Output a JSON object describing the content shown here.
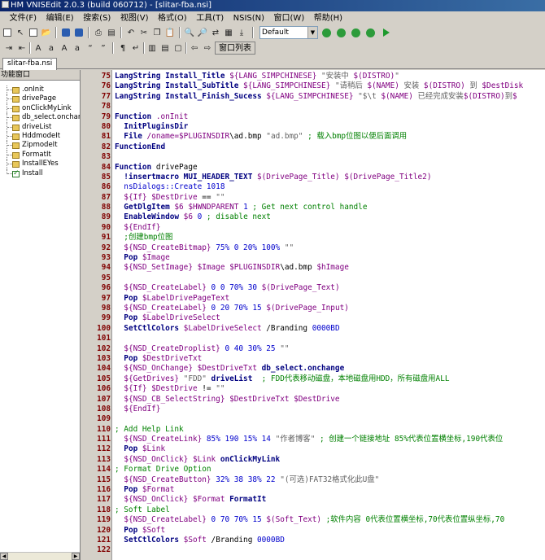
{
  "window": {
    "title": "HM VNISEdit 2.0.3 (build 060712) - [slitar-fba.nsi]"
  },
  "menu": [
    "文件(F)",
    "编辑(E)",
    "搜索(S)",
    "视图(V)",
    "格式(O)",
    "工具(T)",
    "NSIS(N)",
    "窗口(W)",
    "帮助(H)"
  ],
  "toolbar": {
    "scheme_value": "Default",
    "window_list_label": "窗口列表"
  },
  "tabs": [
    {
      "label": "slitar-fba.nsi",
      "active": true
    }
  ],
  "sidebar": {
    "title": "功能窗口",
    "items": [
      {
        "label": ".onInit",
        "icon": "function-icon"
      },
      {
        "label": "drivePage",
        "icon": "function-icon"
      },
      {
        "label": "onClickMyLink",
        "icon": "function-icon"
      },
      {
        "label": "db_select.onchar",
        "icon": "function-icon"
      },
      {
        "label": "driveList",
        "icon": "function-icon"
      },
      {
        "label": "HddmodeIt",
        "icon": "function-icon"
      },
      {
        "label": "ZipmodeIt",
        "icon": "function-icon"
      },
      {
        "label": "FormatIt",
        "icon": "function-icon"
      },
      {
        "label": "InstallEYes",
        "icon": "function-icon"
      },
      {
        "label": "Install",
        "icon": "section-check-icon"
      }
    ]
  },
  "code_lines": [
    {
      "n": "75",
      "t": [
        [
          "kw",
          "LangString Install_Title "
        ],
        [
          "var",
          "${LANG_SIMPCHINESE} "
        ],
        [
          "str",
          "\"安装中 "
        ],
        [
          "var",
          "$(DISTRO)"
        ],
        [
          "str",
          "\""
        ]
      ]
    },
    {
      "n": "76",
      "t": [
        [
          "kw",
          "LangString Install_SubTitle "
        ],
        [
          "var",
          "${LANG_SIMPCHINESE} "
        ],
        [
          "str",
          "\"请稍后 "
        ],
        [
          "var",
          "$(NAME)"
        ],
        [
          "str",
          " 安装 "
        ],
        [
          "var",
          "$(DISTRO)"
        ],
        [
          "str",
          " 到 "
        ],
        [
          "var",
          "$DestDisk"
        ]
      ]
    },
    {
      "n": "77",
      "t": [
        [
          "kw",
          "LangString Install_Finish_Sucess "
        ],
        [
          "var",
          "${LANG_SIMPCHINESE} "
        ],
        [
          "str",
          "\"$\\t "
        ],
        [
          "var",
          "$(NAME)"
        ],
        [
          "str",
          " 已经完成安装"
        ],
        [
          "var",
          "$(DISTRO)"
        ],
        [
          "str",
          "到"
        ],
        [
          "var",
          "$"
        ]
      ]
    },
    {
      "n": "78",
      "t": []
    },
    {
      "n": "79",
      "t": [
        [
          "kw",
          "Function "
        ],
        [
          "var",
          ".onInit"
        ]
      ]
    },
    {
      "n": "80",
      "t": [
        [
          "plain",
          "  "
        ],
        [
          "kw",
          "InitPluginsDir"
        ]
      ]
    },
    {
      "n": "81",
      "t": [
        [
          "plain",
          "  "
        ],
        [
          "kw",
          "File "
        ],
        [
          "var",
          "/oname=$PLUGINSDIR"
        ],
        [
          "plain",
          "\\ad.bmp "
        ],
        [
          "str",
          "\"ad.bmp\""
        ],
        [
          "cm",
          " ; 载入bmp位图以便后面调用"
        ]
      ]
    },
    {
      "n": "82",
      "t": [
        [
          "kw",
          "FunctionEnd"
        ]
      ]
    },
    {
      "n": "83",
      "t": []
    },
    {
      "n": "84",
      "t": [
        [
          "kw",
          "Function "
        ],
        [
          "plain",
          "drivePage"
        ]
      ]
    },
    {
      "n": "85",
      "t": [
        [
          "plain",
          "  "
        ],
        [
          "kw",
          "!insertmacro MUI_HEADER_TEXT "
        ],
        [
          "var",
          "$(DrivePage_Title) $(DrivePage_Title2)"
        ]
      ]
    },
    {
      "n": "86",
      "t": [
        [
          "plain",
          "  "
        ],
        [
          "num",
          "nsDialogs::Create 1018"
        ]
      ]
    },
    {
      "n": "87",
      "t": [
        [
          "plain",
          "  "
        ],
        [
          "var",
          "${If} $DestDrive"
        ],
        [
          "plain",
          " == "
        ],
        [
          "str",
          "\"\""
        ]
      ]
    },
    {
      "n": "88",
      "t": [
        [
          "plain",
          "  "
        ],
        [
          "kw",
          "GetDlgItem "
        ],
        [
          "var",
          "$6 $HWNDPARENT "
        ],
        [
          "num",
          "1"
        ],
        [
          "cm",
          " ; Get next control handle"
        ]
      ]
    },
    {
      "n": "89",
      "t": [
        [
          "plain",
          "  "
        ],
        [
          "kw",
          "EnableWindow "
        ],
        [
          "var",
          "$6 "
        ],
        [
          "num",
          "0"
        ],
        [
          "cm",
          " ; disable next"
        ]
      ]
    },
    {
      "n": "90",
      "t": [
        [
          "plain",
          "  "
        ],
        [
          "var",
          "${EndIf}"
        ]
      ]
    },
    {
      "n": "91",
      "t": [
        [
          "plain",
          "  "
        ],
        [
          "cm",
          ";创建bmp位图"
        ]
      ]
    },
    {
      "n": "92",
      "t": [
        [
          "plain",
          "  "
        ],
        [
          "var",
          "${NSD_CreateBitmap} "
        ],
        [
          "num",
          "75% 0 20% 100%"
        ],
        [
          "str",
          " \"\""
        ]
      ]
    },
    {
      "n": "93",
      "t": [
        [
          "plain",
          "  "
        ],
        [
          "kw",
          "Pop "
        ],
        [
          "var",
          "$Image"
        ]
      ]
    },
    {
      "n": "94",
      "t": [
        [
          "plain",
          "  "
        ],
        [
          "var",
          "${NSD_SetImage} $Image $PLUGINSDIR"
        ],
        [
          "plain",
          "\\ad.bmp "
        ],
        [
          "var",
          "$hImage"
        ]
      ]
    },
    {
      "n": "95",
      "t": []
    },
    {
      "n": "96",
      "t": [
        [
          "plain",
          "  "
        ],
        [
          "var",
          "${NSD_CreateLabel} "
        ],
        [
          "num",
          "0 0 70% 30"
        ],
        [
          "var",
          " $(DrivePage_Text)"
        ]
      ]
    },
    {
      "n": "97",
      "t": [
        [
          "plain",
          "  "
        ],
        [
          "kw",
          "Pop "
        ],
        [
          "var",
          "$LabelDrivePageText"
        ]
      ]
    },
    {
      "n": "98",
      "t": [
        [
          "plain",
          "  "
        ],
        [
          "var",
          "${NSD_CreateLabel} "
        ],
        [
          "num",
          "0 20 70% 15"
        ],
        [
          "var",
          " $(DrivePage_Input)"
        ]
      ]
    },
    {
      "n": "99",
      "t": [
        [
          "plain",
          "  "
        ],
        [
          "kw",
          "Pop "
        ],
        [
          "var",
          "$LabelDriveSelect"
        ]
      ]
    },
    {
      "n": "100",
      "t": [
        [
          "plain",
          "  "
        ],
        [
          "kw",
          "SetCtlColors "
        ],
        [
          "var",
          "$LabelDriveSelect "
        ],
        [
          "plain",
          "/Branding "
        ],
        [
          "num",
          "0000BD"
        ]
      ]
    },
    {
      "n": "101",
      "t": []
    },
    {
      "n": "102",
      "t": [
        [
          "plain",
          "  "
        ],
        [
          "var",
          "${NSD_CreateDroplist} "
        ],
        [
          "num",
          "0 40 30% 25"
        ],
        [
          "str",
          " \"\""
        ]
      ]
    },
    {
      "n": "103",
      "t": [
        [
          "plain",
          "  "
        ],
        [
          "kw",
          "Pop "
        ],
        [
          "var",
          "$DestDriveTxt"
        ]
      ]
    },
    {
      "n": "104",
      "t": [
        [
          "plain",
          "  "
        ],
        [
          "var",
          "${NSD_OnChange} $DestDriveTxt "
        ],
        [
          "kw",
          "db_select.onchange"
        ]
      ]
    },
    {
      "n": "105",
      "t": [
        [
          "plain",
          "  "
        ],
        [
          "var",
          "${GetDrives} "
        ],
        [
          "str",
          "\"FDD\""
        ],
        [
          "kw",
          " driveList"
        ],
        [
          "cm",
          "  ; FDD代表移动磁盘，本地磁盘用HDD，所有磁盘用ALL"
        ]
      ]
    },
    {
      "n": "106",
      "t": [
        [
          "plain",
          "  "
        ],
        [
          "var",
          "${If} $DestDrive"
        ],
        [
          "plain",
          " != "
        ],
        [
          "str",
          "\"\""
        ]
      ]
    },
    {
      "n": "107",
      "t": [
        [
          "plain",
          "  "
        ],
        [
          "var",
          "${NSD_CB_SelectString} $DestDriveTxt $DestDrive"
        ]
      ]
    },
    {
      "n": "108",
      "t": [
        [
          "plain",
          "  "
        ],
        [
          "var",
          "${EndIf}"
        ]
      ]
    },
    {
      "n": "109",
      "t": []
    },
    {
      "n": "110",
      "t": [
        [
          "cm",
          "; Add Help Link"
        ]
      ]
    },
    {
      "n": "111",
      "t": [
        [
          "plain",
          "  "
        ],
        [
          "var",
          "${NSD_CreateLink} "
        ],
        [
          "num",
          "85% 190 15% 14"
        ],
        [
          "str",
          " \"作者博客\""
        ],
        [
          "cm",
          " ; 创建一个链接地址 85%代表位置横坐标,190代表位"
        ]
      ]
    },
    {
      "n": "112",
      "t": [
        [
          "plain",
          "  "
        ],
        [
          "kw",
          "Pop "
        ],
        [
          "var",
          "$Link"
        ]
      ]
    },
    {
      "n": "113",
      "t": [
        [
          "plain",
          "  "
        ],
        [
          "var",
          "${NSD_OnClick} $Link "
        ],
        [
          "kw",
          "onClickMyLink"
        ]
      ]
    },
    {
      "n": "114",
      "t": [
        [
          "cm",
          "; Format Drive Option"
        ]
      ]
    },
    {
      "n": "115",
      "t": [
        [
          "plain",
          "  "
        ],
        [
          "var",
          "${NSD_CreateButton} "
        ],
        [
          "num",
          "32% 38 38% 22"
        ],
        [
          "str",
          " \"(可选)FAT32格式化此U盘\""
        ]
      ]
    },
    {
      "n": "116",
      "t": [
        [
          "plain",
          "  "
        ],
        [
          "kw",
          "Pop "
        ],
        [
          "var",
          "$Format"
        ]
      ]
    },
    {
      "n": "117",
      "t": [
        [
          "plain",
          "  "
        ],
        [
          "var",
          "${NSD_OnClick} $Format "
        ],
        [
          "kw",
          "FormatIt"
        ]
      ]
    },
    {
      "n": "118",
      "t": [
        [
          "cm",
          "; Soft Label"
        ]
      ]
    },
    {
      "n": "119",
      "t": [
        [
          "plain",
          "  "
        ],
        [
          "var",
          "${NSD_CreateLabel} "
        ],
        [
          "num",
          "0 70 70% 15"
        ],
        [
          "var",
          " $(Soft_Text)"
        ],
        [
          "cm",
          " ;软件内容 0代表位置横坐标,70代表位置纵坐标,70"
        ]
      ]
    },
    {
      "n": "120",
      "t": [
        [
          "plain",
          "  "
        ],
        [
          "kw",
          "Pop "
        ],
        [
          "var",
          "$Soft"
        ]
      ]
    },
    {
      "n": "121",
      "t": [
        [
          "plain",
          "  "
        ],
        [
          "kw",
          "SetCtlColors "
        ],
        [
          "var",
          "$Soft "
        ],
        [
          "plain",
          "/Branding "
        ],
        [
          "num",
          "0000BD"
        ]
      ]
    },
    {
      "n": "122",
      "t": []
    }
  ]
}
